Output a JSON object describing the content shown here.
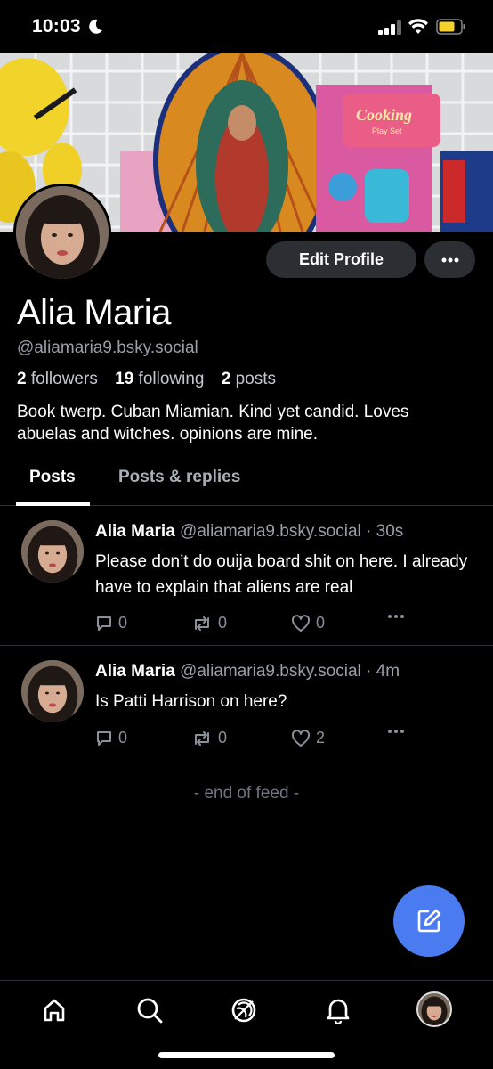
{
  "status_bar": {
    "time": "10:03"
  },
  "profile": {
    "display_name": "Alia Maria",
    "handle": "@aliamaria9.bsky.social",
    "followers_count": "2",
    "followers_label": "followers",
    "following_count": "19",
    "following_label": "following",
    "posts_count": "2",
    "posts_label": "posts",
    "bio": "Book twerp. Cuban Miamian. Kind yet candid. Loves abuelas and witches. opinions are mine.",
    "edit_button": "Edit Profile"
  },
  "tabs": [
    {
      "label": "Posts",
      "active": true
    },
    {
      "label": "Posts & replies",
      "active": false
    }
  ],
  "posts": [
    {
      "author": "Alia Maria",
      "handle": "@aliamaria9.bsky.social",
      "time": "· 30s",
      "text": "Please don’t do ouija board shit on here. I already have to explain that aliens are real",
      "replies": "0",
      "reposts": "0",
      "likes": "0"
    },
    {
      "author": "Alia Maria",
      "handle": "@aliamaria9.bsky.social",
      "time": "· 4m",
      "text": "Is Patti Harrison on here?",
      "replies": "0",
      "reposts": "0",
      "likes": "2"
    }
  ],
  "end_of_feed": "- end of feed -",
  "colors": {
    "accent": "#4b7bf0",
    "background": "#000000",
    "button_bg": "#2b2e33",
    "muted": "#9aa0a8"
  },
  "icons": [
    "moon-icon",
    "signal-icon",
    "wifi-icon",
    "battery-icon",
    "ellipsis-icon",
    "reply-icon",
    "repost-icon",
    "heart-icon",
    "compose-icon",
    "home-icon",
    "search-icon",
    "feeds-icon",
    "bell-icon"
  ]
}
